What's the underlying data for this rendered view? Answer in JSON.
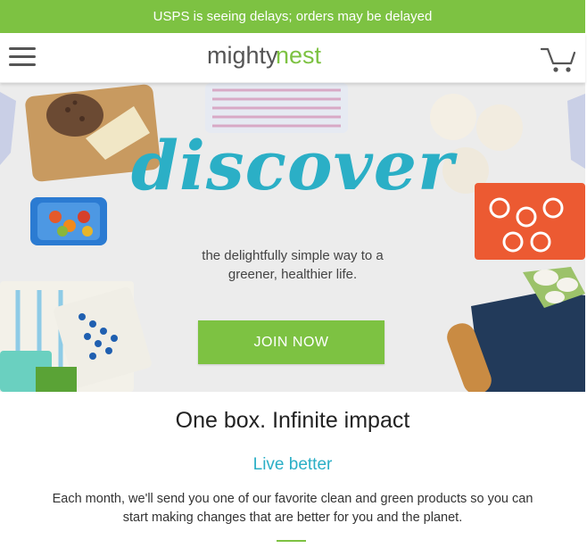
{
  "banner": {
    "text": "USPS is seeing delays; orders may be delayed"
  },
  "header": {
    "logo": {
      "part1": "mighty",
      "part2": "nest"
    },
    "menu_icon": "hamburger-menu-icon",
    "cart_icon": "shopping-cart-icon"
  },
  "hero": {
    "title": "discover",
    "subtitle_line1": "the delightfully simple way to a",
    "subtitle_line2": "greener, healthier life.",
    "cta_label": "JOIN NOW"
  },
  "content": {
    "headline": "One box. Infinite impact",
    "subhead": "Live better",
    "body_line1": "Each month, we'll send you one of our favorite clean and green products so you can",
    "body_line2": "start making changes that are better for you and the planet."
  },
  "colors": {
    "brand_green": "#7dc242",
    "accent_teal": "#2bafc6",
    "logo_gray": "#555555",
    "hero_bg": "#ececec"
  }
}
